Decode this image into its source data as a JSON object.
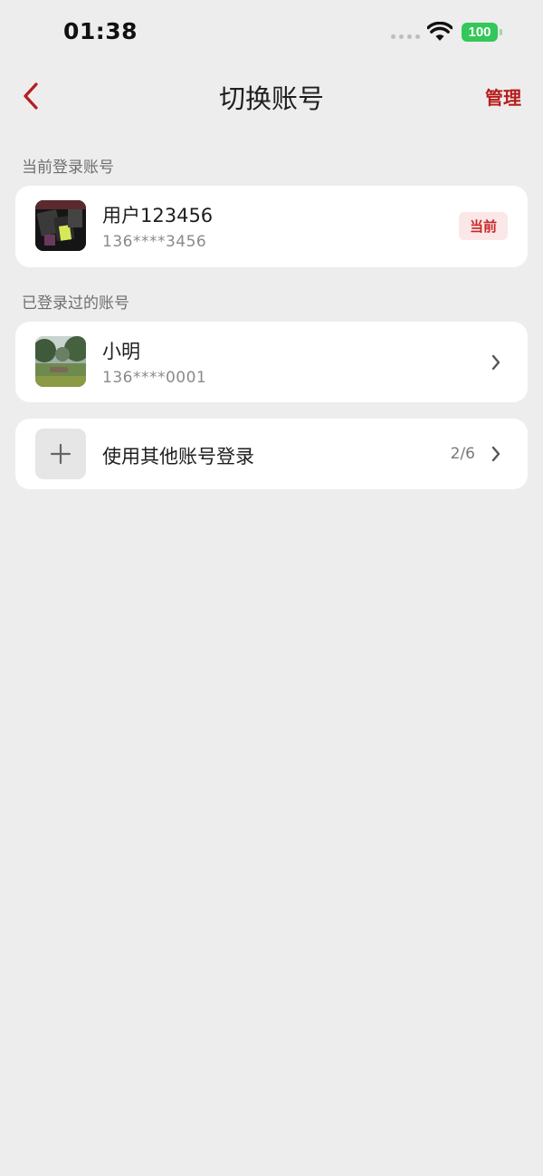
{
  "status_bar": {
    "time": "01:38",
    "battery": "100",
    "battery_color": "#34c759"
  },
  "nav": {
    "back_icon": "chevron-left-icon",
    "title": "切换账号",
    "manage_label": "管理",
    "accent_color": "#b71c1c"
  },
  "current_section": {
    "label": "当前登录账号",
    "account": {
      "name": "用户123456",
      "phone": "136****3456",
      "badge": "当前"
    }
  },
  "history_section": {
    "label": "已登录过的账号",
    "accounts": [
      {
        "name": "小明",
        "phone": "136****0001"
      }
    ]
  },
  "add_account": {
    "label": "使用其他账号登录",
    "count": "2/6",
    "icon": "plus-icon"
  }
}
